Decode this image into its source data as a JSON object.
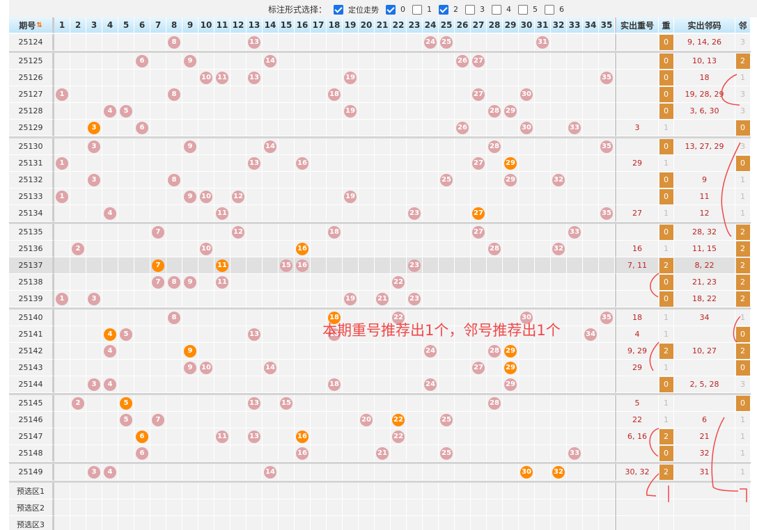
{
  "toolbar": {
    "label": "标注形式选择：",
    "options": [
      {
        "label": "定位走势",
        "checked": true
      },
      {
        "label": "0",
        "checked": true
      },
      {
        "label": "1",
        "checked": false
      },
      {
        "label": "2",
        "checked": true
      },
      {
        "label": "3",
        "checked": false
      },
      {
        "label": "4",
        "checked": false
      },
      {
        "label": "5",
        "checked": false
      },
      {
        "label": "6",
        "checked": false
      }
    ]
  },
  "header": {
    "period": "期号",
    "sort_icon": "sort-arrows-icon",
    "extra": [
      "实出重号",
      "重",
      "实出邻码",
      "邻"
    ]
  },
  "colors": {
    "ball": "#dea4a8",
    "ball_repeat": "#ff8a00",
    "mark": "#d9913a",
    "annotation": "#f04848"
  },
  "annotation": "本期重号推荐出1个，邻号推荐出1个",
  "rows": [
    {
      "period": "25124",
      "nums": [
        8,
        13,
        24,
        25,
        31
      ],
      "orange": [],
      "repeat": "",
      "rc": "0",
      "adj": "9, 14, 26",
      "ac": "3"
    },
    {
      "period": "25125",
      "nums": [
        6,
        9,
        14,
        26,
        27
      ],
      "orange": [],
      "repeat": "",
      "rc": "0",
      "adj": "10, 13",
      "ac": "2"
    },
    {
      "period": "25126",
      "nums": [
        10,
        11,
        13,
        19,
        35
      ],
      "orange": [],
      "repeat": "",
      "rc": "0",
      "adj": "18",
      "ac": "1"
    },
    {
      "period": "25127",
      "nums": [
        1,
        8,
        18,
        27,
        30
      ],
      "orange": [],
      "repeat": "",
      "rc": "0",
      "adj": "19, 28, 29",
      "ac": "3"
    },
    {
      "period": "25128",
      "nums": [
        4,
        5,
        19,
        28,
        29
      ],
      "orange": [],
      "repeat": "",
      "rc": "0",
      "adj": "3, 6, 30",
      "ac": "3"
    },
    {
      "period": "25129",
      "nums": [
        3,
        6,
        26,
        30,
        33
      ],
      "orange": [
        3
      ],
      "repeat": "3",
      "rc": "1",
      "adj": "",
      "ac": "0"
    },
    {
      "period": "25130",
      "nums": [
        3,
        9,
        14,
        28,
        35
      ],
      "orange": [],
      "repeat": "",
      "rc": "0",
      "adj": "13, 27, 29",
      "ac": "3"
    },
    {
      "period": "25131",
      "nums": [
        1,
        13,
        16,
        27,
        29
      ],
      "orange": [
        29
      ],
      "repeat": "29",
      "rc": "1",
      "adj": "",
      "ac": "0"
    },
    {
      "period": "25132",
      "nums": [
        3,
        8,
        25,
        29,
        32
      ],
      "orange": [],
      "repeat": "",
      "rc": "0",
      "adj": "9",
      "ac": "1"
    },
    {
      "period": "25133",
      "nums": [
        1,
        9,
        10,
        12,
        19
      ],
      "orange": [],
      "repeat": "",
      "rc": "0",
      "adj": "11",
      "ac": "1"
    },
    {
      "period": "25134",
      "nums": [
        4,
        11,
        23,
        27,
        35
      ],
      "orange": [
        27
      ],
      "repeat": "27",
      "rc": "1",
      "adj": "12",
      "ac": "1"
    },
    {
      "period": "25135",
      "nums": [
        7,
        12,
        18,
        27,
        33
      ],
      "orange": [],
      "repeat": "",
      "rc": "0",
      "adj": "28, 32",
      "ac": "2"
    },
    {
      "period": "25136",
      "nums": [
        2,
        10,
        16,
        28,
        32
      ],
      "orange": [
        16
      ],
      "repeat": "16",
      "rc": "1",
      "adj": "11, 15",
      "ac": "2"
    },
    {
      "period": "25137",
      "nums": [
        7,
        11,
        15,
        16,
        23
      ],
      "orange": [
        7,
        11
      ],
      "repeat": "7, 11",
      "rc": "2",
      "adj": "8, 22",
      "ac": "2",
      "highlight": true
    },
    {
      "period": "25138",
      "nums": [
        7,
        8,
        9,
        11,
        22
      ],
      "orange": [],
      "repeat": "",
      "rc": "0",
      "adj": "21, 23",
      "ac": "2"
    },
    {
      "period": "25139",
      "nums": [
        1,
        3,
        19,
        21,
        23
      ],
      "orange": [],
      "repeat": "",
      "rc": "0",
      "adj": "18, 22",
      "ac": "2"
    },
    {
      "period": "25140",
      "nums": [
        8,
        18,
        22,
        30,
        35
      ],
      "orange": [
        18
      ],
      "repeat": "18",
      "rc": "1",
      "adj": "34",
      "ac": "1"
    },
    {
      "period": "25141",
      "nums": [
        4,
        5,
        13,
        18,
        34
      ],
      "orange": [
        4
      ],
      "repeat": "4",
      "rc": "1",
      "adj": "",
      "ac": "0"
    },
    {
      "period": "25142",
      "nums": [
        4,
        9,
        24,
        28,
        29
      ],
      "orange": [
        9,
        29
      ],
      "repeat": "9, 29",
      "rc": "2",
      "adj": "10, 27",
      "ac": "2"
    },
    {
      "period": "25143",
      "nums": [
        9,
        10,
        14,
        27,
        29
      ],
      "orange": [
        29
      ],
      "repeat": "29",
      "rc": "1",
      "adj": "",
      "ac": "0"
    },
    {
      "period": "25144",
      "nums": [
        3,
        4,
        18,
        24,
        29
      ],
      "orange": [],
      "repeat": "",
      "rc": "0",
      "adj": "2, 5, 28",
      "ac": "3"
    },
    {
      "period": "25145",
      "nums": [
        2,
        5,
        13,
        15,
        28
      ],
      "orange": [
        5
      ],
      "repeat": "5",
      "rc": "1",
      "adj": "",
      "ac": "0"
    },
    {
      "period": "25146",
      "nums": [
        5,
        7,
        20,
        22,
        25
      ],
      "orange": [
        22
      ],
      "repeat": "22",
      "rc": "1",
      "adj": "6",
      "ac": "1"
    },
    {
      "period": "25147",
      "nums": [
        6,
        11,
        13,
        16,
        22
      ],
      "orange": [
        6,
        16
      ],
      "repeat": "6, 16",
      "rc": "2",
      "adj": "21",
      "ac": "1"
    },
    {
      "period": "25148",
      "nums": [
        6,
        16,
        21,
        25,
        33
      ],
      "orange": [],
      "repeat": "",
      "rc": "0",
      "adj": "32",
      "ac": "1"
    },
    {
      "period": "25149",
      "nums": [
        3,
        4,
        14,
        30,
        32
      ],
      "orange": [
        30,
        32
      ],
      "repeat": "30, 32",
      "rc": "2",
      "adj": "31",
      "ac": "1"
    }
  ],
  "preselect": [
    "预选区1",
    "预选区2",
    "预选区3"
  ],
  "marked_values": [
    "0",
    "2"
  ]
}
